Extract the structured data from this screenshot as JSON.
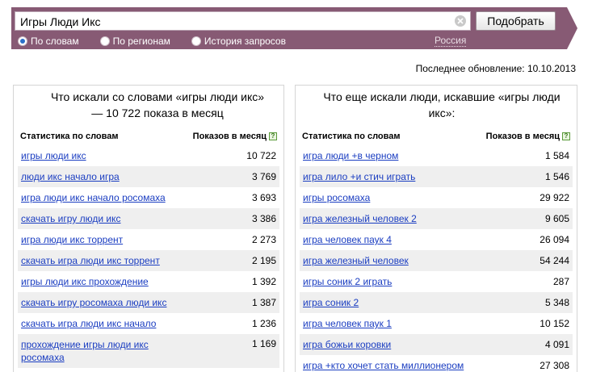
{
  "search": {
    "query": "Игры Люди Икс",
    "submit_label": "Подобрать",
    "modes": [
      {
        "label": "По словам",
        "checked": true
      },
      {
        "label": "По регионам",
        "checked": false
      },
      {
        "label": "История запросов",
        "checked": false
      }
    ],
    "region": "Россия"
  },
  "last_update": "Последнее обновление: 10.10.2013",
  "left_panel": {
    "title": "Что искали со словами «игры люди икс» — 10 722 показа в месяц",
    "col_words": "Статистика по словам",
    "col_shows": "Показов в месяц",
    "rows": [
      {
        "phrase": "игры люди икс",
        "count": "10 722"
      },
      {
        "phrase": "люди икс начало игра",
        "count": "3 769"
      },
      {
        "phrase": "игра люди икс начало росомаха",
        "count": "3 693"
      },
      {
        "phrase": "скачать игру люди икс",
        "count": "3 386"
      },
      {
        "phrase": "игра люди икс торрент",
        "count": "2 273"
      },
      {
        "phrase": "скачать игра люди икс торрент",
        "count": "2 195"
      },
      {
        "phrase": "игры люди икс прохождение",
        "count": "1 392"
      },
      {
        "phrase": "скачать игру росомаха люди икс",
        "count": "1 387"
      },
      {
        "phrase": "скачать игра люди икс начало",
        "count": "1 236"
      },
      {
        "phrase": "прохождение игры люди икс росомаха",
        "count": "1 169"
      }
    ]
  },
  "right_panel": {
    "title": "Что еще искали люди, искавшие «игры люди икс»:",
    "col_words": "Статистика по словам",
    "col_shows": "Показов в месяц",
    "rows": [
      {
        "phrase": "игра люди +в черном",
        "count": "1 584"
      },
      {
        "phrase": "игра лило +и стич играть",
        "count": "1 546"
      },
      {
        "phrase": "игры росомаха",
        "count": "29 922"
      },
      {
        "phrase": "игра железный человек 2",
        "count": "9 605"
      },
      {
        "phrase": "игра человек паук 4",
        "count": "26 094"
      },
      {
        "phrase": "игра железный человек",
        "count": "54 244"
      },
      {
        "phrase": "игры соник 2 играть",
        "count": "287"
      },
      {
        "phrase": "игра соник 2",
        "count": "5 348"
      },
      {
        "phrase": "игра человек паук 1",
        "count": "10 152"
      },
      {
        "phrase": "игра божьи коровки",
        "count": "4 091"
      },
      {
        "phrase": "игра +кто хочет стать миллионером",
        "count": "27 308"
      }
    ]
  },
  "help_glyph": "?",
  "colors": {
    "band": "#875a74",
    "link": "#1a3dc1",
    "row_alt": "#efefef"
  }
}
